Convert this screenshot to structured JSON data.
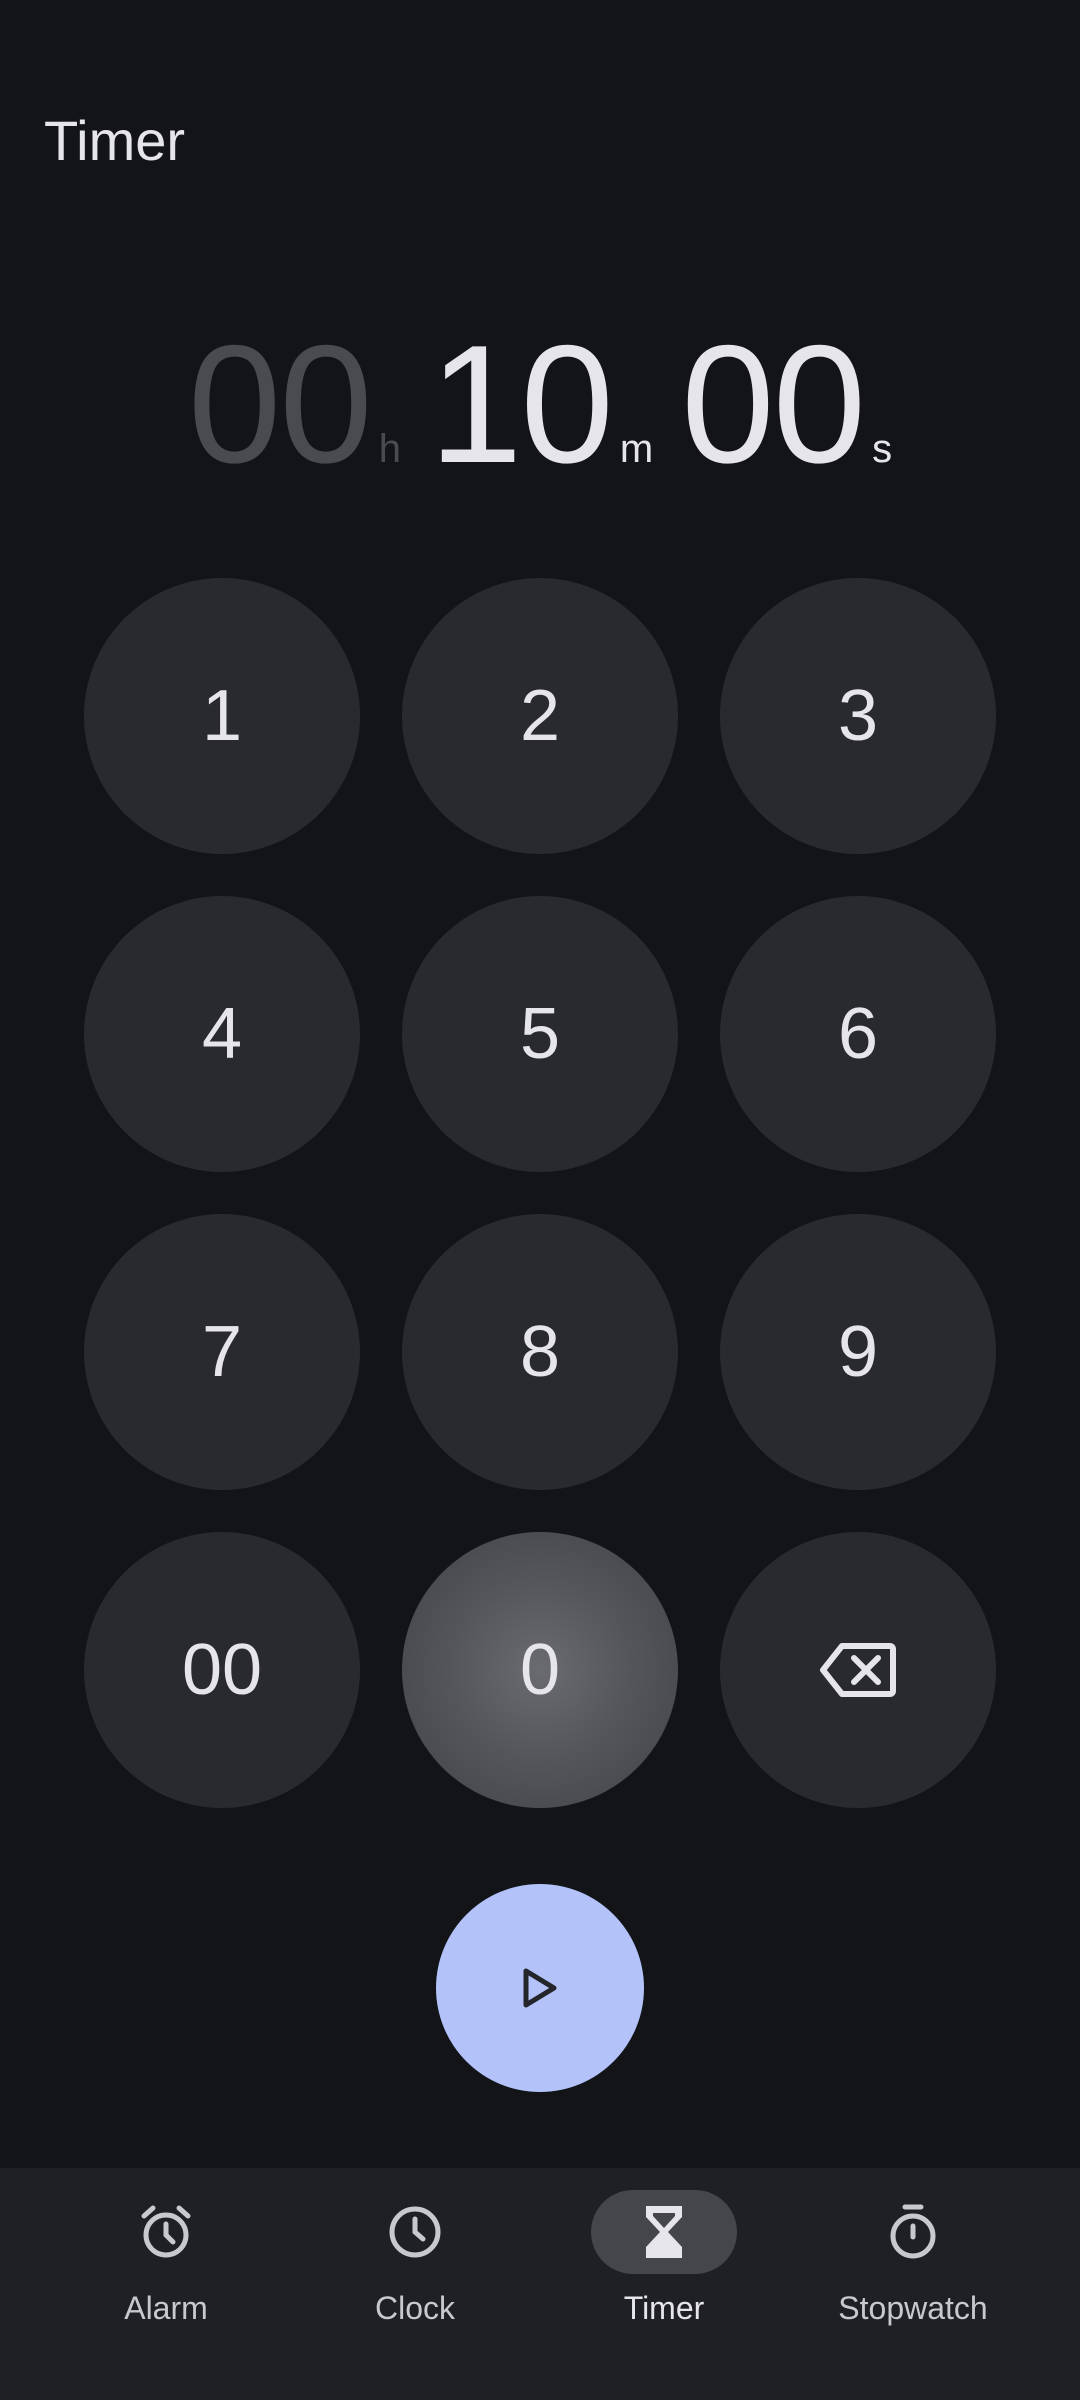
{
  "app": {
    "title": "Timer"
  },
  "display": {
    "hours": "00",
    "hours_unit": "h",
    "minutes": "10",
    "minutes_unit": "m",
    "seconds": "00",
    "seconds_unit": "s"
  },
  "keypad": {
    "k1": "1",
    "k2": "2",
    "k3": "3",
    "k4": "4",
    "k5": "5",
    "k6": "6",
    "k7": "7",
    "k8": "8",
    "k9": "9",
    "k00": "00",
    "k0": "0",
    "backspace_icon": "backspace-icon"
  },
  "start": {
    "icon": "play-icon",
    "color": "#b3c3fa"
  },
  "nav": {
    "items": [
      {
        "label": "Alarm",
        "icon": "alarm-icon"
      },
      {
        "label": "Clock",
        "icon": "clock-icon"
      },
      {
        "label": "Timer",
        "icon": "hourglass-icon",
        "active": true
      },
      {
        "label": "Stopwatch",
        "icon": "stopwatch-icon"
      }
    ]
  },
  "colors": {
    "background": "#131418",
    "key": "#292a2f",
    "nav_active": "#45464c"
  }
}
